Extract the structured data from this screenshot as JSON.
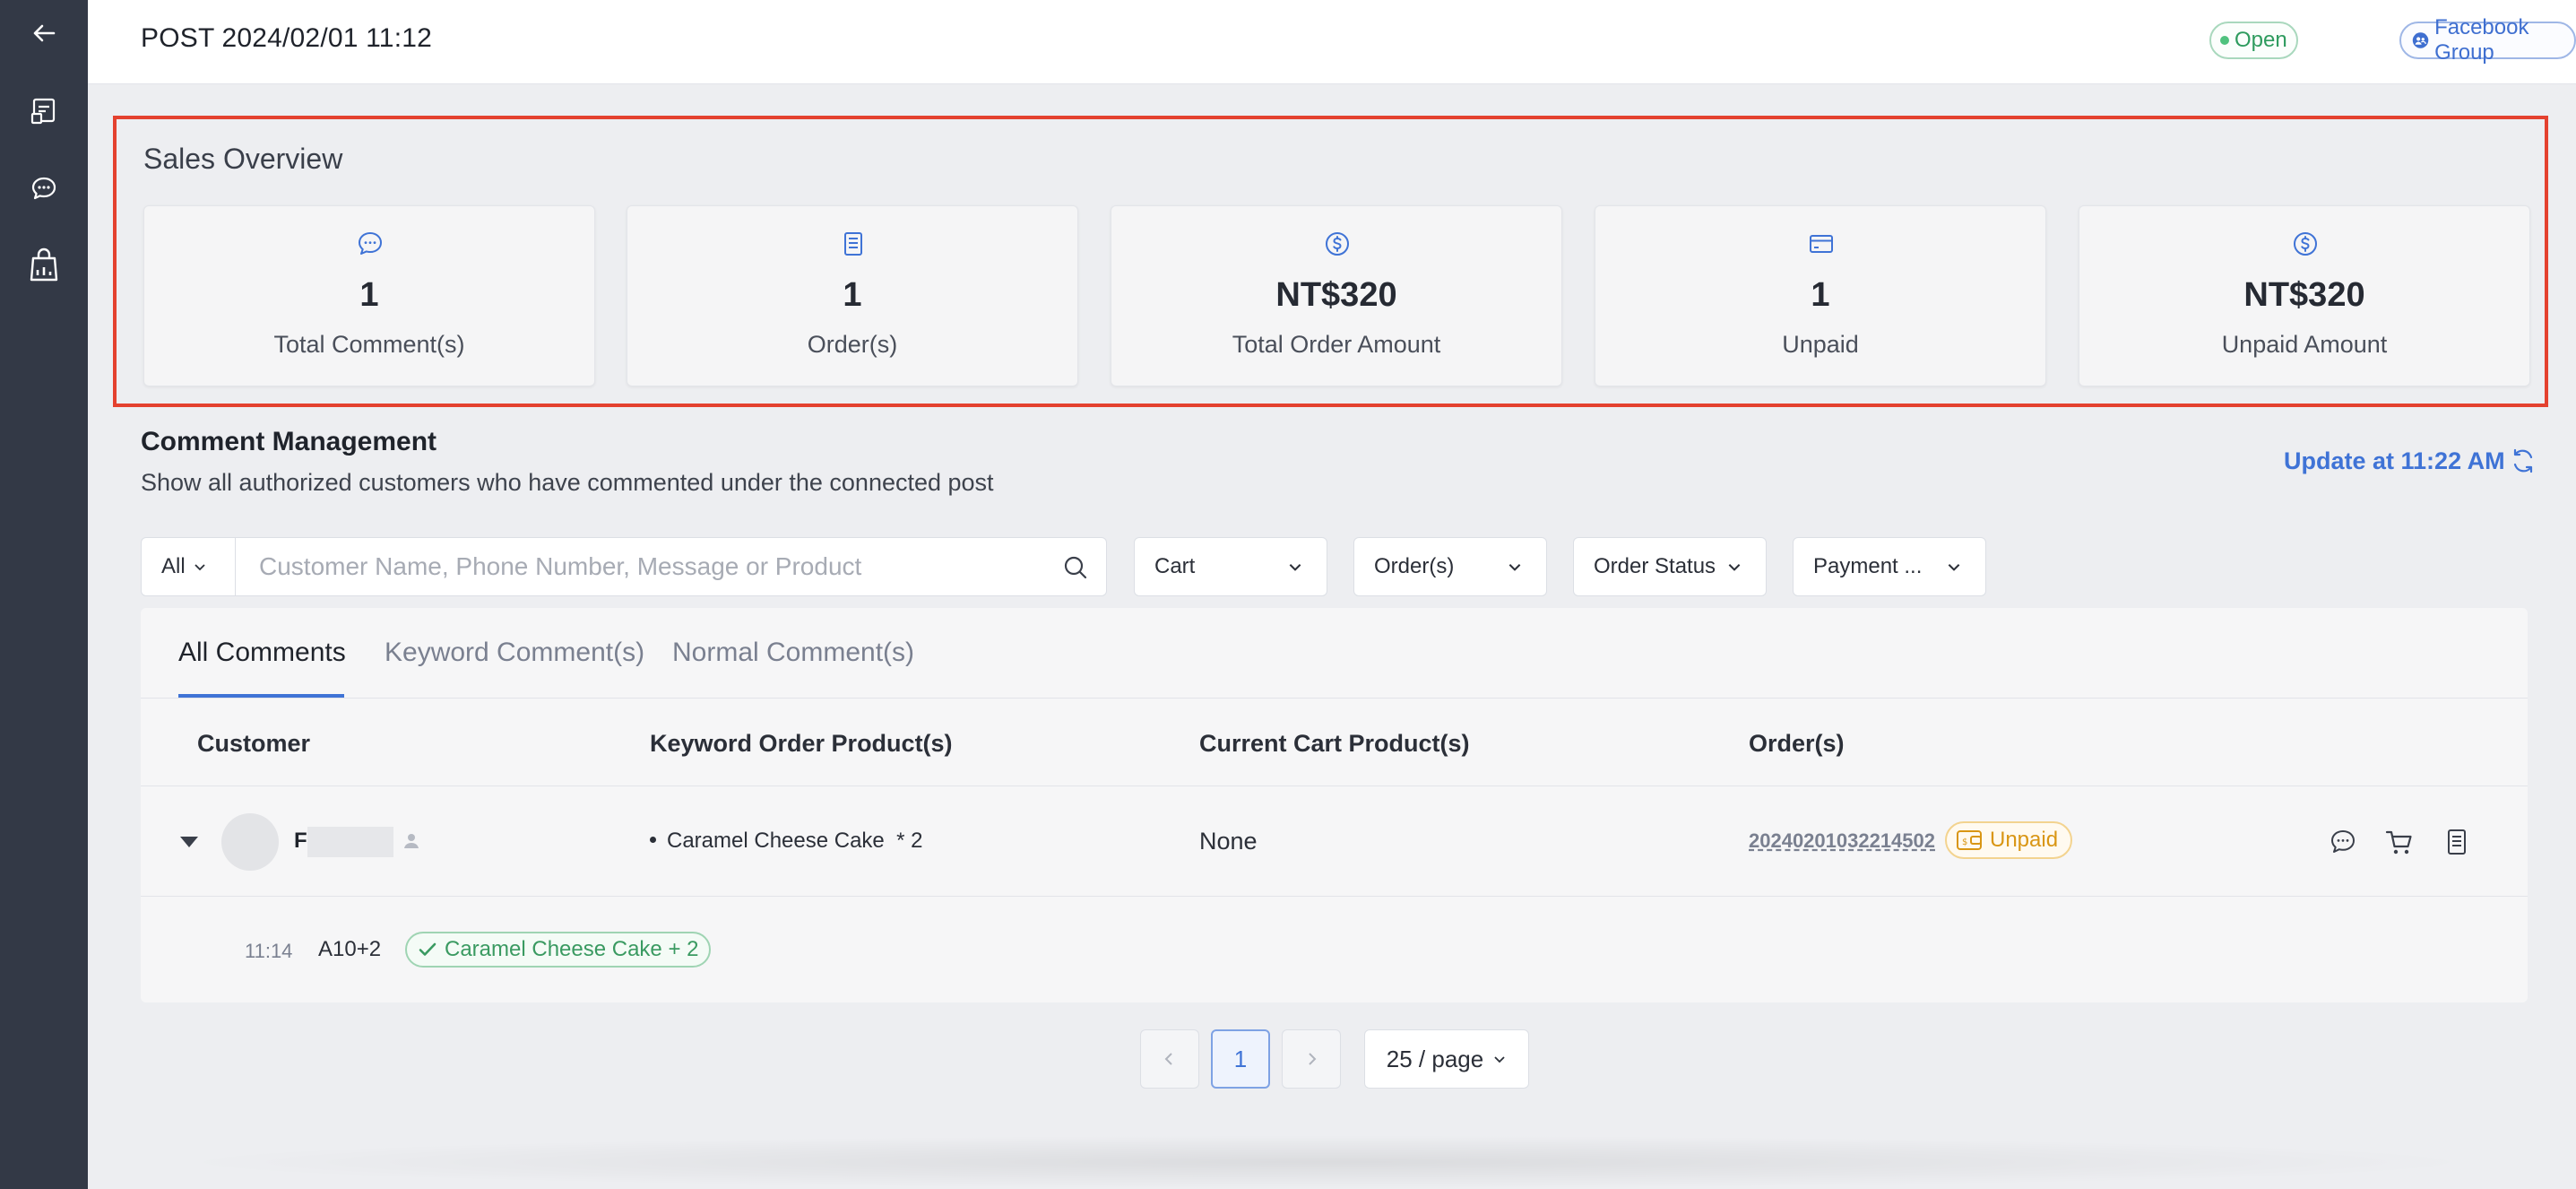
{
  "sidebar": {
    "icons": [
      "back-arrow-icon",
      "posts-icon",
      "chat-icon",
      "shop-analytics-icon"
    ]
  },
  "header": {
    "post_title": "POST 2024/02/01 11:12",
    "status_badge": "Open",
    "group_badge": "Facebook Group"
  },
  "overview": {
    "title": "Sales Overview",
    "cards": [
      {
        "icon": "comment-icon",
        "value": "1",
        "label": "Total Comment(s)"
      },
      {
        "icon": "order-icon",
        "value": "1",
        "label": "Order(s)"
      },
      {
        "icon": "dollar-icon",
        "value": "NT$320",
        "label": "Total Order Amount"
      },
      {
        "icon": "card-icon",
        "value": "1",
        "label": "Unpaid"
      },
      {
        "icon": "dollar-icon",
        "value": "NT$320",
        "label": "Unpaid Amount"
      }
    ]
  },
  "comments": {
    "title": "Comment Management",
    "subtitle": "Show all authorized customers who have commented under the connected post",
    "update_label": "Update at 11:22 AM"
  },
  "filters": {
    "scope": "All",
    "search_placeholder": "Customer Name, Phone Number, Message or Product",
    "dropdowns": [
      "Cart",
      "Order(s)",
      "Order Status",
      "Payment ..."
    ]
  },
  "tabs": [
    "All Comments",
    "Keyword Comment(s)",
    "Normal Comment(s)"
  ],
  "table": {
    "columns": [
      "Customer",
      "Keyword Order Product(s)",
      "Current Cart Product(s)",
      "Order(s)"
    ],
    "rows": [
      {
        "customer_initial": "F",
        "keyword_product": "Caramel Cheese Cake",
        "keyword_qty": "* 2",
        "cart": "None",
        "order_no": "20240201032214502",
        "order_status": "Unpaid",
        "message": {
          "time": "11:14",
          "text": "A10+2",
          "matched": "Caramel Cheese Cake + 2"
        }
      }
    ]
  },
  "pagination": {
    "current_page": "1",
    "page_size": "25 / page"
  }
}
